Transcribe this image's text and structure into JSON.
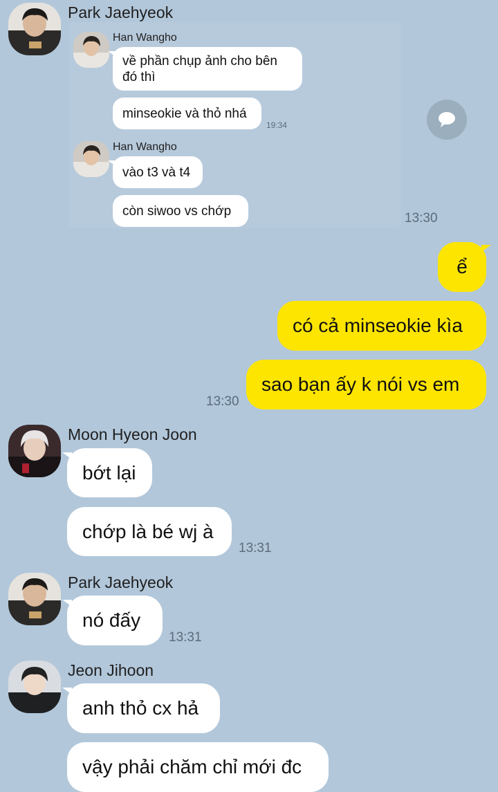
{
  "colors": {
    "background": "#b2c7da",
    "my_bubble": "#fee500",
    "their_bubble": "#ffffff"
  },
  "forward_card": {
    "sender": "Park Jaehyeok",
    "time": "13:30",
    "inner": [
      {
        "sender": "Han Wangho",
        "messages": [
          "về phần chụp ảnh cho bên đó thì",
          "minseokie và thỏ nhá"
        ],
        "time": "19:34"
      },
      {
        "sender": "Han Wangho",
        "messages": [
          "vào t3 và t4",
          "còn siwoo vs chớp"
        ]
      }
    ],
    "share_icon": "speech-bubble-icon"
  },
  "my_messages": {
    "items": [
      "ể",
      "có cả minseokie kìa",
      "sao bạn ấy k nói vs em"
    ],
    "time": "13:30"
  },
  "groups": [
    {
      "sender": "Moon Hyeon Joon",
      "messages": [
        "bớt lại",
        "chớp là bé wj à"
      ],
      "time": "13:31"
    },
    {
      "sender": "Park Jaehyeok",
      "messages": [
        "nó đấy"
      ],
      "time": "13:31"
    },
    {
      "sender": "Jeon Jihoon",
      "messages": [
        "anh thỏ cx hả",
        "vậy phải chăm chỉ mới đc"
      ]
    }
  ]
}
